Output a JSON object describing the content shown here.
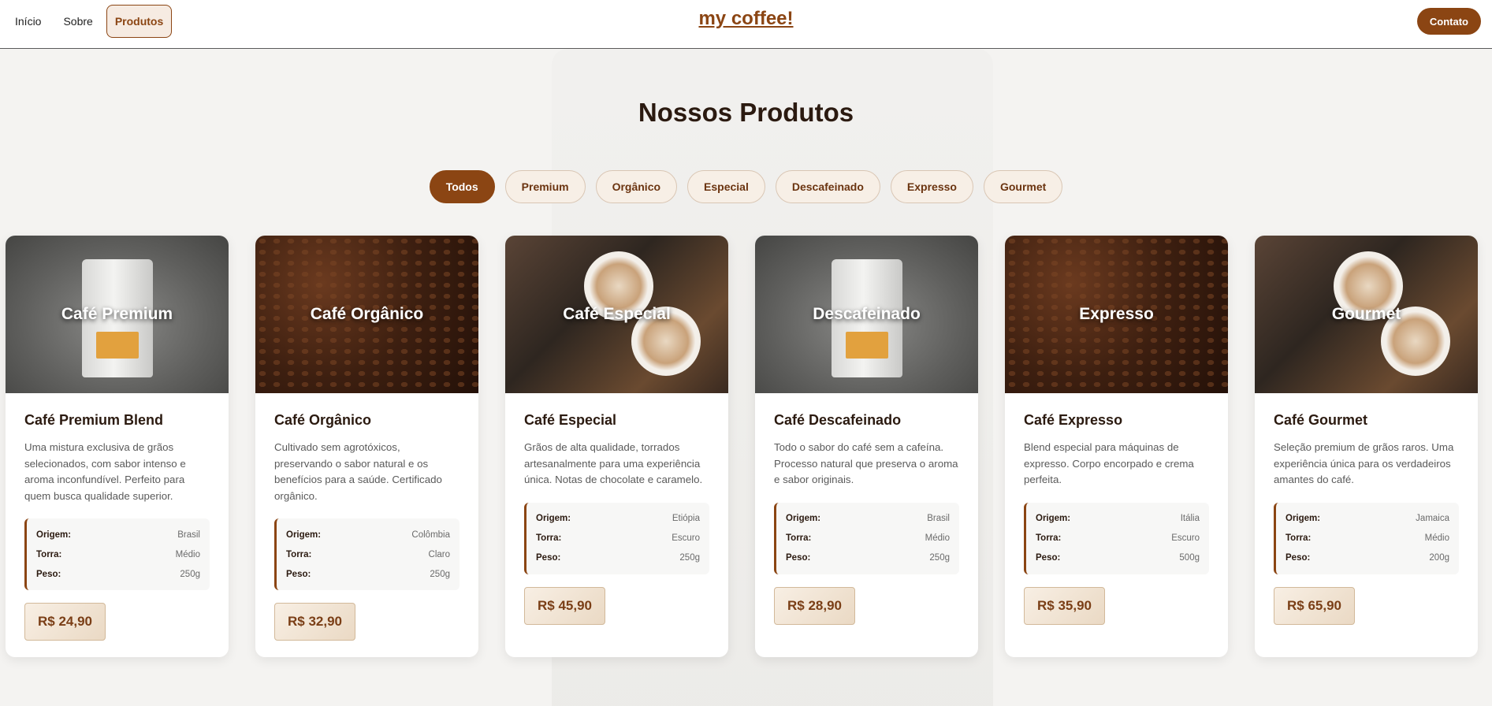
{
  "nav": {
    "items": [
      {
        "label": "Início"
      },
      {
        "label": "Sobre"
      },
      {
        "label": "Produtos"
      }
    ]
  },
  "brand": "my coffee!",
  "contact_label": "Contato",
  "section_title": "Nossos Produtos",
  "filters": [
    "Todos",
    "Premium",
    "Orgânico",
    "Especial",
    "Descafeinado",
    "Expresso",
    "Gourmet"
  ],
  "spec_labels": {
    "origin": "Origem:",
    "roast": "Torra:",
    "weight": "Peso:"
  },
  "products": [
    {
      "overlay": "Café Premium",
      "title": "Café Premium Blend",
      "desc": "Uma mistura exclusiva de grãos selecionados, com sabor intenso e aroma inconfundível. Perfeito para quem busca qualidade superior.",
      "origin": "Brasil",
      "roast": "Médio",
      "weight": "250g",
      "price": "R$ 24,90",
      "image": "coffee-bag"
    },
    {
      "overlay": "Café Orgânico",
      "title": "Café Orgânico",
      "desc": "Cultivado sem agrotóxicos, preservando o sabor natural e os benefícios para a saúde. Certificado orgânico.",
      "origin": "Colômbia",
      "roast": "Claro",
      "weight": "250g",
      "price": "R$ 32,90",
      "image": "coffee-beans"
    },
    {
      "overlay": "Café Especial",
      "title": "Café Especial",
      "desc": "Grãos de alta qualidade, torrados artesanalmente para uma experiência única. Notas de chocolate e caramelo.",
      "origin": "Etiópia",
      "roast": "Escuro",
      "weight": "250g",
      "price": "R$ 45,90",
      "image": "latte-cups"
    },
    {
      "overlay": "Descafeinado",
      "title": "Café Descafeinado",
      "desc": "Todo o sabor do café sem a cafeína. Processo natural que preserva o aroma e sabor originais.",
      "origin": "Brasil",
      "roast": "Médio",
      "weight": "250g",
      "price": "R$ 28,90",
      "image": "coffee-bag"
    },
    {
      "overlay": "Expresso",
      "title": "Café Expresso",
      "desc": "Blend especial para máquinas de expresso. Corpo encorpado e crema perfeita.",
      "origin": "Itália",
      "roast": "Escuro",
      "weight": "500g",
      "price": "R$ 35,90",
      "image": "coffee-beans"
    },
    {
      "overlay": "Gourmet",
      "title": "Café Gourmet",
      "desc": "Seleção premium de grãos raros. Uma experiência única para os verdadeiros amantes do café.",
      "origin": "Jamaica",
      "roast": "Médio",
      "weight": "200g",
      "price": "R$ 65,90",
      "image": "latte-cups"
    }
  ]
}
